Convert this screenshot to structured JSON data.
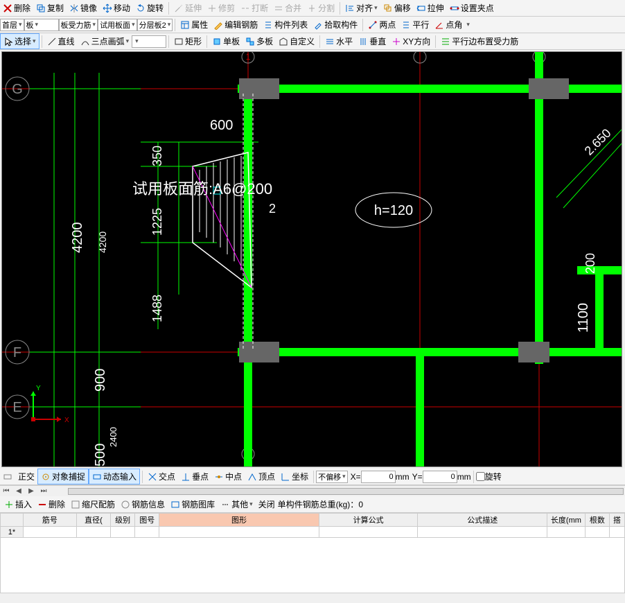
{
  "toolbar1": {
    "delete": "删除",
    "copy": "复制",
    "mirror": "镜像",
    "move": "移动",
    "rotate": "旋转",
    "extend": "延伸",
    "trim": "修剪",
    "break": "打断",
    "merge": "合并",
    "split": "分割",
    "align": "对齐",
    "offset": "偏移",
    "stretch": "拉伸",
    "setpoint": "设置夹点"
  },
  "toolbar2": {
    "floor": "首层",
    "slab": "板",
    "slabforce": "板受力筋",
    "trialslab": "试用板面",
    "layerslab": "分层板2",
    "attr": "属性",
    "editrebar": "编辑钢筋",
    "componentlist": "构件列表",
    "pick": "拾取构件",
    "twopoint": "两点",
    "parallel": "平行",
    "pointangle": "点角"
  },
  "toolbar3": {
    "select": "选择",
    "line": "直线",
    "arc3p": "三点画弧",
    "rect": "矩形",
    "single": "单板",
    "multi": "多板",
    "custom": "自定义",
    "horiz": "水平",
    "vert": "垂直",
    "xy": "XY方向",
    "parallelLayout": "平行边布置受力筋"
  },
  "canvas": {
    "gridG": "G",
    "gridF": "F",
    "gridE": "E",
    "dim600": "600",
    "dim350": "350",
    "dim4200": "4200",
    "dim4200b": "4200",
    "dim1225": "1225",
    "dim1488": "1488",
    "dim900": "900",
    "dim500": "500",
    "dim2400": "2400",
    "dim2650": "2.650",
    "dim1100": "1100",
    "dim200": "200",
    "rebartext": "试用板面筋:A6@200",
    "htext": "h=120",
    "idx2": "2",
    "axisX": "X",
    "axisY": "Y",
    "bubble1a": "1",
    "bubble1b": "1"
  },
  "toolbar4": {
    "ortho": "正交",
    "snap": "对象捕捉",
    "dyninput": "动态输入",
    "inter": "交点",
    "perp": "垂点",
    "mid": "中点",
    "apex": "顶点",
    "coord": "坐标",
    "nooffset": "不偏移",
    "X": "X=",
    "Y": "Y=",
    "xval": "0",
    "yval": "0",
    "mm": "mm",
    "rotate": "旋转"
  },
  "toolbar5": {
    "insert": "插入",
    "delete": "删除",
    "scale": "缩尺配筋",
    "rebarinfo": "钢筋信息",
    "rebarlib": "钢筋图库",
    "other": "其他",
    "close": "关闭",
    "total_label": "单构件钢筋总重(kg)：",
    "total_val": "0"
  },
  "table": {
    "cols": {
      "num": "筋号",
      "dia": "直径(",
      "grade": "级别",
      "code": "图号",
      "graphic": "图形",
      "formula": "计算公式",
      "desc": "公式描述",
      "len": "长度(mm",
      "qty": "根数",
      "lap": "搭"
    },
    "row1": "1*"
  }
}
